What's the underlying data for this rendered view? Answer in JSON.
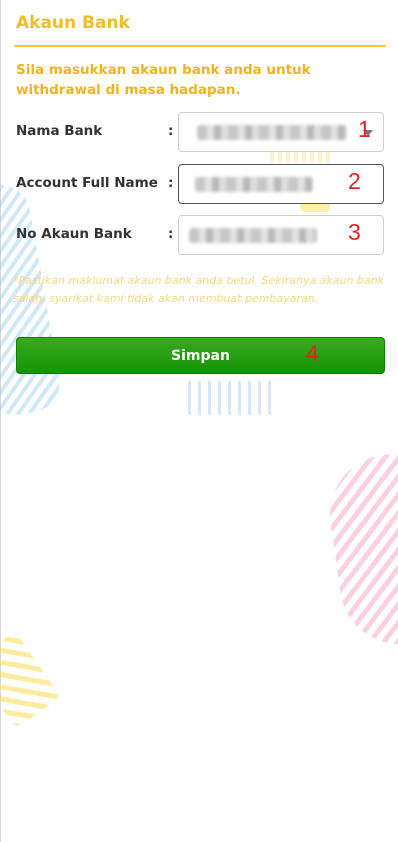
{
  "page": {
    "title": "Akaun Bank",
    "instruction": "Sila masukkan akaun bank anda untuk withdrawal di masa hadapan.",
    "note": "*Pastikan maklumat akaun bank anda betul. Sekiranya akaun bank salah, syarikat kami tidak akan membuat pembayaran."
  },
  "form": {
    "colon": ":",
    "bank_name": {
      "label": "Nama Bank",
      "marker": "1",
      "value_icon": "blurred-select-value"
    },
    "full_name": {
      "label": "Account Full Name",
      "marker": "2",
      "value_icon": "blurred-input-value"
    },
    "account_no": {
      "label": "No Akaun Bank",
      "marker": "3",
      "value_icon": "blurred-input-value"
    }
  },
  "save": {
    "label": "Simpan",
    "marker": "4"
  },
  "colors": {
    "accent": "#f2bd2a",
    "button_green": "#1f9c0e",
    "marker_red": "#e52222",
    "note_yellow": "#f6d77f"
  }
}
